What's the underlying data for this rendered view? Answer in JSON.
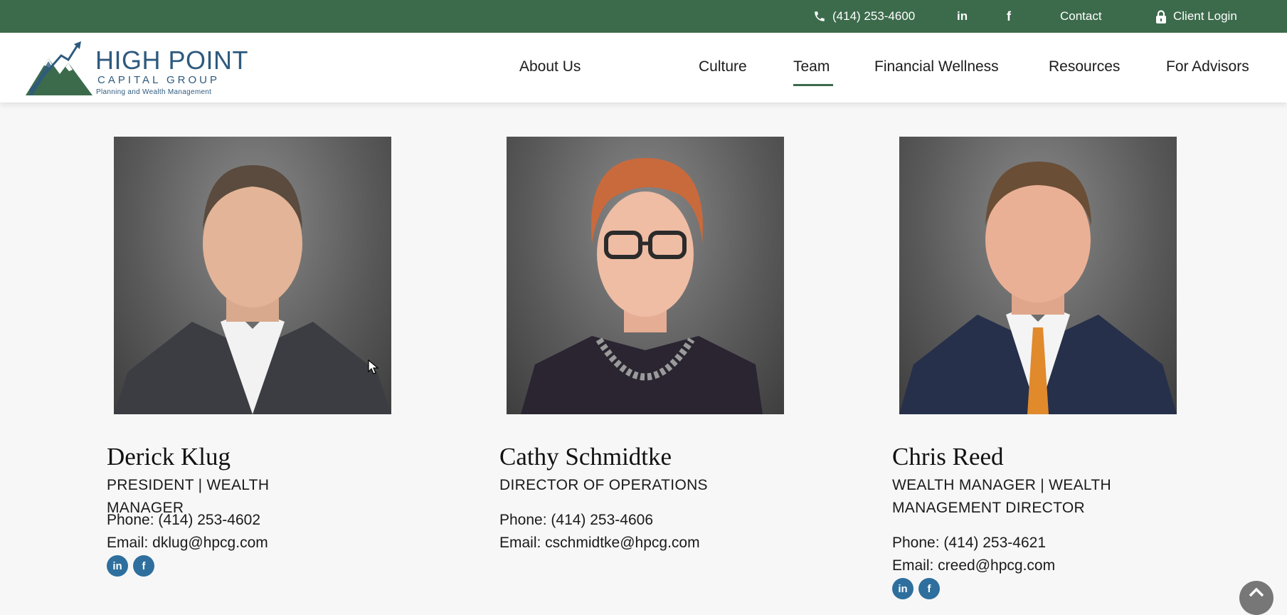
{
  "topbar": {
    "phone_icon": "phone-icon",
    "phone": "(414) 253-4600",
    "linkedin_label": "in",
    "facebook_label": "f",
    "contact": "Contact",
    "lock_icon": "lock-icon",
    "client_login": "Client Login"
  },
  "logo": {
    "line1": "HIGH POINT",
    "line2": "CAPITAL GROUP",
    "line3": "Planning and Wealth Management"
  },
  "nav": {
    "items": [
      "About Us",
      "Culture",
      "Team",
      "Financial Wellness",
      "Resources",
      "For Advisors"
    ],
    "active": "Team"
  },
  "team": [
    {
      "name": "Derick Klug",
      "title": "PRESIDENT | WEALTH MANAGER",
      "phone": "Phone: (414) 253-4602",
      "email": "Email: dklug@hpcg.com",
      "social": [
        "in",
        "f"
      ]
    },
    {
      "name": "Cathy Schmidtke",
      "title": "DIRECTOR OF OPERATIONS",
      "phone": "Phone: (414) 253-4606",
      "email": "Email: cschmidtke@hpcg.com",
      "social": []
    },
    {
      "name": "Chris Reed",
      "title": "WEALTH MANAGER | WEALTH MANAGEMENT DIRECTOR",
      "phone": "Phone: (414) 253-4621",
      "email": "Email: creed@hpcg.com",
      "social": [
        "in",
        "f"
      ]
    }
  ],
  "colors": {
    "brand_green": "#3c6b4c",
    "brand_blue": "#2e5a7e",
    "social_blue": "#2e6f9e"
  }
}
